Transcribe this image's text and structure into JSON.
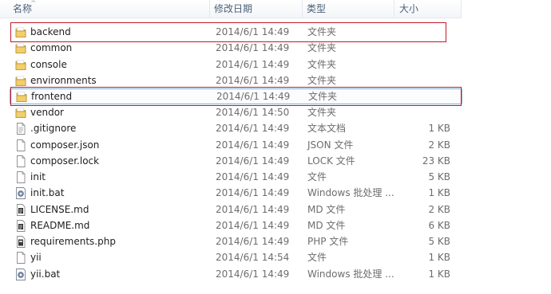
{
  "columns": {
    "name": "名称",
    "date": "修改日期",
    "type": "类型",
    "size": "大小"
  },
  "files": [
    {
      "name": "backend",
      "date": "2014/6/1 14:49",
      "type": "文件夹",
      "size": "",
      "icon": "folder"
    },
    {
      "name": "common",
      "date": "2014/6/1 14:49",
      "type": "文件夹",
      "size": "",
      "icon": "folder"
    },
    {
      "name": "console",
      "date": "2014/6/1 14:49",
      "type": "文件夹",
      "size": "",
      "icon": "folder"
    },
    {
      "name": "environments",
      "date": "2014/6/1 14:49",
      "type": "文件夹",
      "size": "",
      "icon": "folder"
    },
    {
      "name": "frontend",
      "date": "2014/6/1 14:49",
      "type": "文件夹",
      "size": "",
      "icon": "folder",
      "selected": true
    },
    {
      "name": "vendor",
      "date": "2014/6/1 14:50",
      "type": "文件夹",
      "size": "",
      "icon": "folder"
    },
    {
      "name": ".gitignore",
      "date": "2014/6/1 14:49",
      "type": "文本文档",
      "size": "1 KB",
      "icon": "text"
    },
    {
      "name": "composer.json",
      "date": "2014/6/1 14:49",
      "type": "JSON 文件",
      "size": "2 KB",
      "icon": "blank"
    },
    {
      "name": "composer.lock",
      "date": "2014/6/1 14:49",
      "type": "LOCK 文件",
      "size": "23 KB",
      "icon": "blank"
    },
    {
      "name": "init",
      "date": "2014/6/1 14:49",
      "type": "文件",
      "size": "5 KB",
      "icon": "blank"
    },
    {
      "name": "init.bat",
      "date": "2014/6/1 14:49",
      "type": "Windows 批处理 ...",
      "size": "1 KB",
      "icon": "gear"
    },
    {
      "name": "LICENSE.md",
      "date": "2014/6/1 14:49",
      "type": "MD 文件",
      "size": "2 KB",
      "icon": "md"
    },
    {
      "name": "README.md",
      "date": "2014/6/1 14:49",
      "type": "MD 文件",
      "size": "6 KB",
      "icon": "md"
    },
    {
      "name": "requirements.php",
      "date": "2014/6/1 14:49",
      "type": "PHP 文件",
      "size": "5 KB",
      "icon": "php"
    },
    {
      "name": "yii",
      "date": "2014/6/1 14:54",
      "type": "文件",
      "size": "1 KB",
      "icon": "blank"
    },
    {
      "name": "yii.bat",
      "date": "2014/6/1 14:49",
      "type": "Windows 批处理 ...",
      "size": "1 KB",
      "icon": "gear"
    }
  ],
  "colors": {
    "highlight": "#c0192b",
    "folder": "#e8c15c",
    "header_text": "#4c607a",
    "selection_border": "#8fa6cc"
  }
}
